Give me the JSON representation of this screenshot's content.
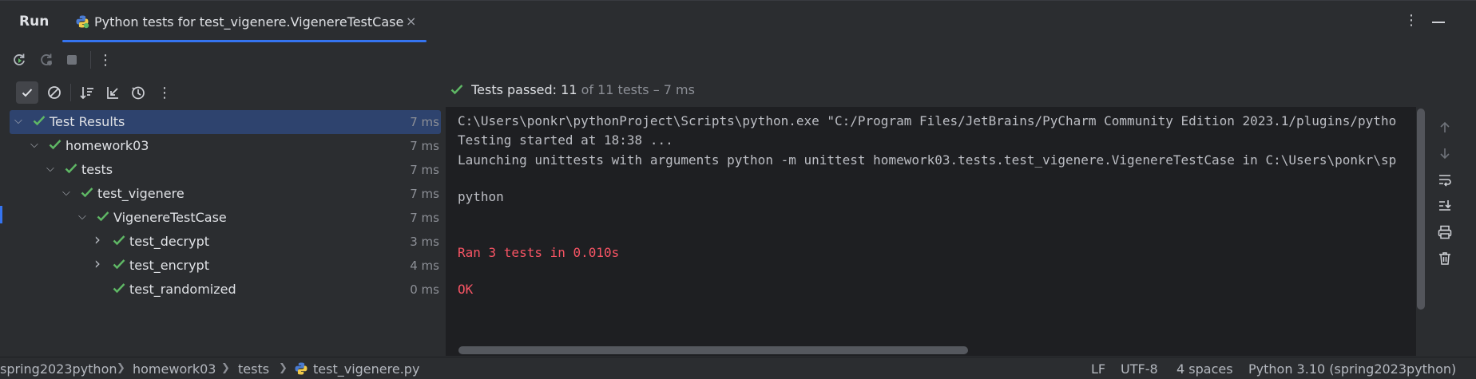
{
  "header": {
    "run_label": "Run",
    "tab_title": "Python tests for test_vigenere.VigenereTestCase",
    "close_glyph": "×",
    "kebab_glyph": "⋮"
  },
  "toolbar": {
    "kebab_glyph": "⋮"
  },
  "status": {
    "passed_label": "Tests passed:",
    "passed_count": "11",
    "total_text": "of 11 tests – 7 ms"
  },
  "tree": [
    {
      "label": "Test Results",
      "time": "7 ms",
      "expanded": true,
      "selected": true
    },
    {
      "label": "homework03",
      "time": "7 ms",
      "expanded": true
    },
    {
      "label": "tests",
      "time": "7 ms",
      "expanded": true
    },
    {
      "label": "test_vigenere",
      "time": "7 ms",
      "expanded": true
    },
    {
      "label": "VigenereTestCase",
      "time": "7 ms",
      "expanded": true
    },
    {
      "label": "test_decrypt",
      "time": "3 ms",
      "expanded": false
    },
    {
      "label": "test_encrypt",
      "time": "4 ms",
      "expanded": false
    },
    {
      "label": "test_randomized",
      "time": "0 ms"
    }
  ],
  "console": [
    {
      "text": "C:\\Users\\ponkr\\pythonProject\\Scripts\\python.exe \"C:/Program Files/JetBrains/PyCharm Community Edition 2023.1/plugins/pytho",
      "red": false
    },
    {
      "text": "Testing started at 18:38 ...",
      "red": false
    },
    {
      "text": "Launching unittests with arguments python -m unittest homework03.tests.test_vigenere.VigenereTestCase in C:\\Users\\ponkr\\sp",
      "red": false
    },
    {
      "text": "python",
      "red": false
    },
    {
      "text": "Ran 3 tests in 0.010s",
      "red": true
    },
    {
      "text": "OK",
      "red": true
    }
  ],
  "statusbar": {
    "breadcrumbs": [
      "spring2023python",
      "homework03",
      "tests",
      "test_vigenere.py"
    ],
    "line_ending": "LF",
    "encoding": "UTF-8",
    "indent": "4 spaces",
    "interpreter": "Python 3.10 (spring2023python)"
  },
  "colors": {
    "accent": "#3574f0",
    "success": "#5fb865",
    "error_text": "#f75464"
  },
  "icons": {
    "rerun": "rerun-icon",
    "rerun_failed": "rerun-failed-icon",
    "stop": "stop-icon",
    "show_passed": "check-icon",
    "show_ignored": "ignored-icon",
    "sort": "sort-icon",
    "import": "import-tests-icon",
    "history": "history-icon",
    "up": "arrow-up-icon",
    "down": "arrow-down-icon",
    "soft_wrap": "soft-wrap-icon",
    "scroll_end": "scroll-to-end-icon",
    "print": "print-icon",
    "trash": "trash-icon",
    "python": "python-icon"
  }
}
